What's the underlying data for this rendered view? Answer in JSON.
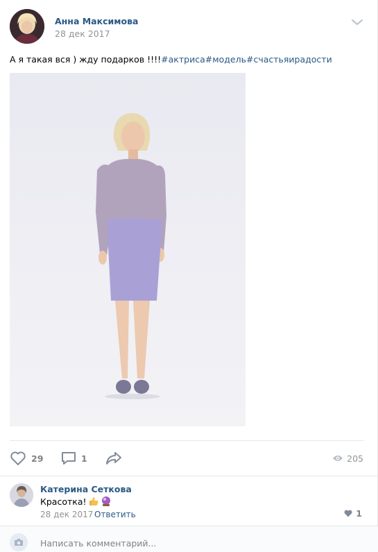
{
  "post": {
    "author": "Анна Максимова",
    "date": "28 дек 2017",
    "text_plain": "А я такая вся ) жду подарков !!!!",
    "hashtags": "#актриса#модель#счастьяирадости"
  },
  "actions": {
    "likes": "29",
    "comments": "1",
    "views": "205"
  },
  "comment": {
    "author": "Катерина Сеткова",
    "text": "Красотка!",
    "date": "28 дек 2017",
    "reply_label": "Ответить",
    "likes": "1"
  },
  "reply_box": {
    "placeholder": "Написать комментарий..."
  },
  "colors": {
    "link": "#2a5885",
    "muted": "#939393",
    "divider": "#e7e8ec"
  }
}
